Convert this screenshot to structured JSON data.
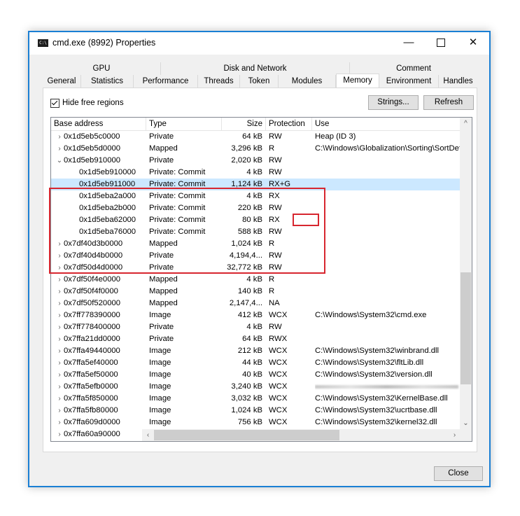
{
  "window": {
    "title": "cmd.exe (8992) Properties",
    "icon_text": "C:\\",
    "controls": {
      "minimize": "—",
      "maximize": "",
      "close": "✕"
    }
  },
  "tabs": {
    "upper": [
      "GPU",
      "Disk and Network",
      "Comment"
    ],
    "lower": [
      "General",
      "Statistics",
      "Performance",
      "Threads",
      "Token",
      "Modules",
      "Memory",
      "Environment",
      "Handles"
    ],
    "active": "Memory"
  },
  "toolbar": {
    "hide_free_label": "Hide free regions",
    "hide_free_checked": true,
    "strings_label": "Strings...",
    "refresh_label": "Refresh"
  },
  "columns": [
    "Base address",
    "Type",
    "Size",
    "Protection",
    "Use"
  ],
  "rows": [
    {
      "addr": "0x1d5eb5c0000",
      "expander": "›",
      "type": "Private",
      "size": "64 kB",
      "prot": "RW",
      "use": "Heap (ID 3)"
    },
    {
      "addr": "0x1d5eb5d0000",
      "expander": "›",
      "type": "Mapped",
      "size": "3,296 kB",
      "prot": "R",
      "use": "C:\\Windows\\Globalization\\Sorting\\SortDefau"
    },
    {
      "addr": "0x1d5eb910000",
      "expander": "⌄",
      "type": "Private",
      "size": "2,020 kB",
      "prot": "RW",
      "use": ""
    },
    {
      "addr": "0x1d5eb910000",
      "expander": "",
      "child": true,
      "type": "Private: Commit",
      "size": "4 kB",
      "prot": "RW",
      "use": ""
    },
    {
      "addr": "0x1d5eb911000",
      "expander": "",
      "child": true,
      "type": "Private: Commit",
      "size": "1,124 kB",
      "prot": "RX+G",
      "use": "",
      "selected": true
    },
    {
      "addr": "0x1d5eba2a000",
      "expander": "",
      "child": true,
      "type": "Private: Commit",
      "size": "4 kB",
      "prot": "RX",
      "use": ""
    },
    {
      "addr": "0x1d5eba2b000",
      "expander": "",
      "child": true,
      "type": "Private: Commit",
      "size": "220 kB",
      "prot": "RW",
      "use": ""
    },
    {
      "addr": "0x1d5eba62000",
      "expander": "",
      "child": true,
      "type": "Private: Commit",
      "size": "80 kB",
      "prot": "RX",
      "use": ""
    },
    {
      "addr": "0x1d5eba76000",
      "expander": "",
      "child": true,
      "type": "Private: Commit",
      "size": "588 kB",
      "prot": "RW",
      "use": ""
    },
    {
      "addr": "0x7df40d3b0000",
      "expander": "›",
      "type": "Mapped",
      "size": "1,024 kB",
      "prot": "R",
      "use": ""
    },
    {
      "addr": "0x7df40d4b0000",
      "expander": "›",
      "type": "Private",
      "size": "4,194,4...",
      "prot": "RW",
      "use": ""
    },
    {
      "addr": "0x7df50d4d0000",
      "expander": "›",
      "type": "Private",
      "size": "32,772 kB",
      "prot": "RW",
      "use": ""
    },
    {
      "addr": "0x7df50f4e0000",
      "expander": "›",
      "type": "Mapped",
      "size": "4 kB",
      "prot": "R",
      "use": ""
    },
    {
      "addr": "0x7df50f4f0000",
      "expander": "›",
      "type": "Mapped",
      "size": "140 kB",
      "prot": "R",
      "use": ""
    },
    {
      "addr": "0x7df50f520000",
      "expander": "›",
      "type": "Mapped",
      "size": "2,147,4...",
      "prot": "NA",
      "use": ""
    },
    {
      "addr": "0x7ff778390000",
      "expander": "›",
      "type": "Image",
      "size": "412 kB",
      "prot": "WCX",
      "use": "C:\\Windows\\System32\\cmd.exe"
    },
    {
      "addr": "0x7ff778400000",
      "expander": "›",
      "type": "Private",
      "size": "4 kB",
      "prot": "RW",
      "use": ""
    },
    {
      "addr": "0x7ffa21dd0000",
      "expander": "›",
      "type": "Private",
      "size": "64 kB",
      "prot": "RWX",
      "use": ""
    },
    {
      "addr": "0x7ffa49440000",
      "expander": "›",
      "type": "Image",
      "size": "212 kB",
      "prot": "WCX",
      "use": "C:\\Windows\\System32\\winbrand.dll"
    },
    {
      "addr": "0x7ffa5ef40000",
      "expander": "›",
      "type": "Image",
      "size": "44 kB",
      "prot": "WCX",
      "use": "C:\\Windows\\System32\\fltLib.dll"
    },
    {
      "addr": "0x7ffa5ef50000",
      "expander": "›",
      "type": "Image",
      "size": "40 kB",
      "prot": "WCX",
      "use": "C:\\Windows\\System32\\version.dll"
    },
    {
      "addr": "0x7ffa5efb0000",
      "expander": "›",
      "type": "Image",
      "size": "3,240 kB",
      "prot": "WCX",
      "use": "",
      "blurred_use": true
    },
    {
      "addr": "0x7ffa5f850000",
      "expander": "›",
      "type": "Image",
      "size": "3,032 kB",
      "prot": "WCX",
      "use": "C:\\Windows\\System32\\KernelBase.dll"
    },
    {
      "addr": "0x7ffa5fb80000",
      "expander": "›",
      "type": "Image",
      "size": "1,024 kB",
      "prot": "WCX",
      "use": "C:\\Windows\\System32\\ucrtbase.dll"
    },
    {
      "addr": "0x7ffa609d0000",
      "expander": "›",
      "type": "Image",
      "size": "756 kB",
      "prot": "WCX",
      "use": "C:\\Windows\\System32\\kernel32.dll"
    },
    {
      "addr": "0x7ffa60a90000",
      "expander": "›",
      "type": "",
      "size": "",
      "prot": "",
      "use": ""
    }
  ],
  "footer": {
    "close_label": "Close"
  },
  "colors": {
    "selection": "#cce8ff",
    "highlight_box": "#d7262f",
    "window_border": "#1a7fd4"
  }
}
